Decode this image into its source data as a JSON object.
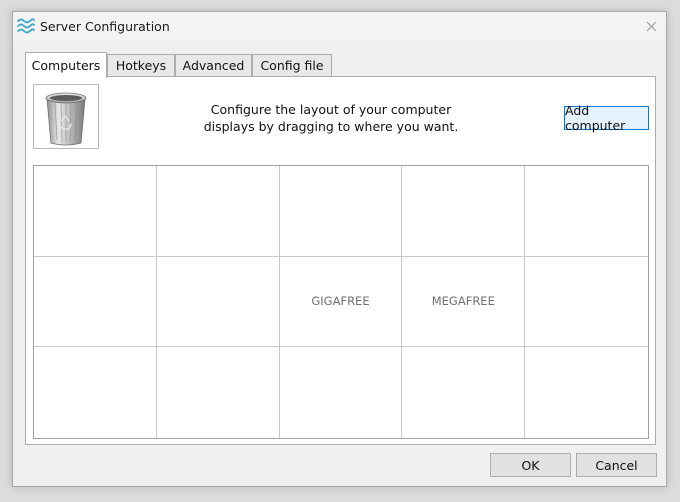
{
  "window": {
    "title": "Server Configuration",
    "app_icon": "waves-icon",
    "close_icon": "close-icon"
  },
  "tabs": [
    {
      "label": "Computers",
      "active": true
    },
    {
      "label": "Hotkeys",
      "active": false
    },
    {
      "label": "Advanced",
      "active": false
    },
    {
      "label": "Config file",
      "active": false
    }
  ],
  "computers": {
    "trash_icon": "trash-icon",
    "instructions": "Configure the layout of your computer displays by dragging to where you want.",
    "add_button": "Add computer",
    "grid": {
      "rows": 3,
      "columns": 5,
      "cells": [
        "",
        "",
        "",
        "",
        "",
        "",
        "",
        "GIGAFREE",
        "MEGAFREE",
        "",
        "",
        "",
        "",
        "",
        ""
      ]
    }
  },
  "footer": {
    "ok": "OK",
    "cancel": "Cancel"
  },
  "colors": {
    "accent": "#0078d7",
    "app_icon": "#3aa6c8"
  }
}
